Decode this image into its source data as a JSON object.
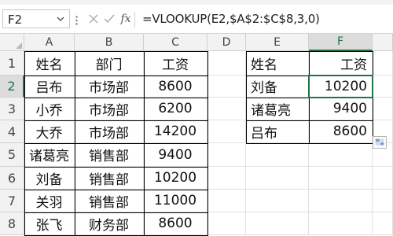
{
  "name_box": "F2",
  "formula": "=VLOOKUP(E2,$A$2:$C$8,3,0)",
  "fx_label": "fx",
  "columns": [
    "A",
    "B",
    "C",
    "D",
    "E",
    "F"
  ],
  "rows": [
    "1",
    "2",
    "3",
    "4",
    "5",
    "6",
    "7",
    "8"
  ],
  "selected_cell": "F2",
  "cells": {
    "A1": "姓名",
    "B1": "部门",
    "C1": "工资",
    "A2": "吕布",
    "B2": "市场部",
    "C2": "8600",
    "A3": "小乔",
    "B3": "市场部",
    "C3": "6200",
    "A4": "大乔",
    "B4": "市场部",
    "C4": "14200",
    "A5": "诸葛亮",
    "B5": "销售部",
    "C5": "9400",
    "A6": "刘备",
    "B6": "销售部",
    "C6": "10200",
    "A7": "关羽",
    "B7": "销售部",
    "C7": "11000",
    "A8": "张飞",
    "B8": "财务部",
    "C8": "8600",
    "E1": "姓名",
    "F1": "工资",
    "E2": "刘备",
    "F2": "10200",
    "E3": "诸葛亮",
    "F3": "9400",
    "E4": "吕布",
    "F4": "8600"
  },
  "colors": {
    "accent": "#217346",
    "header_bg": "#f2f2f2",
    "selected_header_bg": "#dcdcdc",
    "gridline": "#e1e1e1"
  },
  "icons": [
    "chevron-down-icon",
    "grip-icon",
    "cancel-icon",
    "check-icon",
    "fx-icon",
    "quick-analysis-icon"
  ]
}
